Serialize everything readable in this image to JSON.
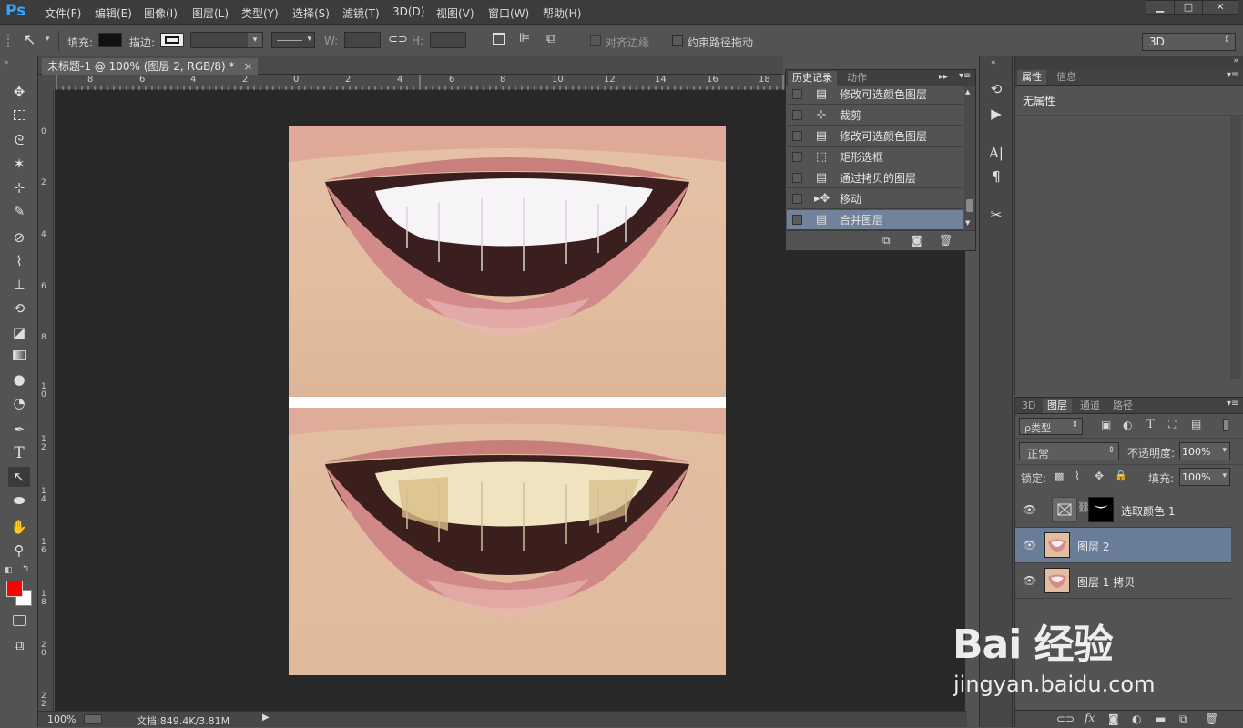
{
  "app": {
    "logo": "Ps"
  },
  "menu": [
    "文件(F)",
    "编辑(E)",
    "图像(I)",
    "图层(L)",
    "类型(Y)",
    "选择(S)",
    "滤镜(T)",
    "3D(D)",
    "视图(V)",
    "窗口(W)",
    "帮助(H)"
  ],
  "window_buttons": {
    "minimize": "▁",
    "maximize": "□",
    "close": "✕"
  },
  "options": {
    "fill_label": "填充:",
    "stroke_label": "描边:",
    "w_label": "W:",
    "h_label": "H:",
    "align_edges": "对齐边缘",
    "constrain_path": "约束路径拖动",
    "workspace": "3D"
  },
  "document": {
    "tab_title": "未标题-1 @ 100% (图层 2, RGB/8) *",
    "close": "×"
  },
  "ruler": {
    "top_ticks": [
      "8",
      "6",
      "4",
      "2",
      "0",
      "2",
      "4",
      "6",
      "8",
      "10",
      "12",
      "14",
      "16",
      "18"
    ],
    "left_ticks": [
      "0",
      "2",
      "4",
      "6",
      "8",
      "1\n0",
      "1\n2",
      "1\n4",
      "1\n6",
      "1\n8",
      "2\n0",
      "2\n2"
    ]
  },
  "status": {
    "zoom": "100%",
    "doc_info": "文档:849.4K/3.81M"
  },
  "history_panel": {
    "tabs": [
      "历史记录",
      "动作"
    ],
    "items": [
      {
        "icon": "doc-icon",
        "label": "修改可选颜色图层",
        "active": false
      },
      {
        "icon": "crop-icon",
        "label": "裁剪",
        "active": false
      },
      {
        "icon": "doc-icon",
        "label": "修改可选颜色图层",
        "active": false
      },
      {
        "icon": "marquee-icon",
        "label": "矩形选框",
        "active": false
      },
      {
        "icon": "doc-icon",
        "label": "通过拷贝的图层",
        "active": false
      },
      {
        "icon": "move-icon",
        "label": "移动",
        "active": false
      },
      {
        "icon": "doc-icon",
        "label": "合并图层",
        "active": true
      }
    ]
  },
  "properties_panel": {
    "tabs": [
      "属性",
      "信息"
    ],
    "content": "无属性"
  },
  "layers_panel": {
    "tabs": [
      "3D",
      "图层",
      "通道",
      "路径"
    ],
    "filter_kind": "ρ类型",
    "blend_mode": "正常",
    "opacity_label": "不透明度:",
    "opacity_value": "100%",
    "lock_label": "锁定:",
    "fill_label": "填充:",
    "fill_value": "100%",
    "layers": [
      {
        "name": "选取颜色 1",
        "type": "adjustment",
        "selected": false
      },
      {
        "name": "图层 2",
        "type": "image",
        "selected": true
      },
      {
        "name": "图层 1 拷贝",
        "type": "image",
        "selected": false
      }
    ]
  },
  "watermark": {
    "brand": "Bai 经验",
    "url": "jingyan.baidu.com"
  },
  "colors": {
    "foreground": "#ff0000",
    "background": "#ffffff",
    "selection_highlight": "#71829a",
    "layer_selected": "#6a7d98"
  }
}
